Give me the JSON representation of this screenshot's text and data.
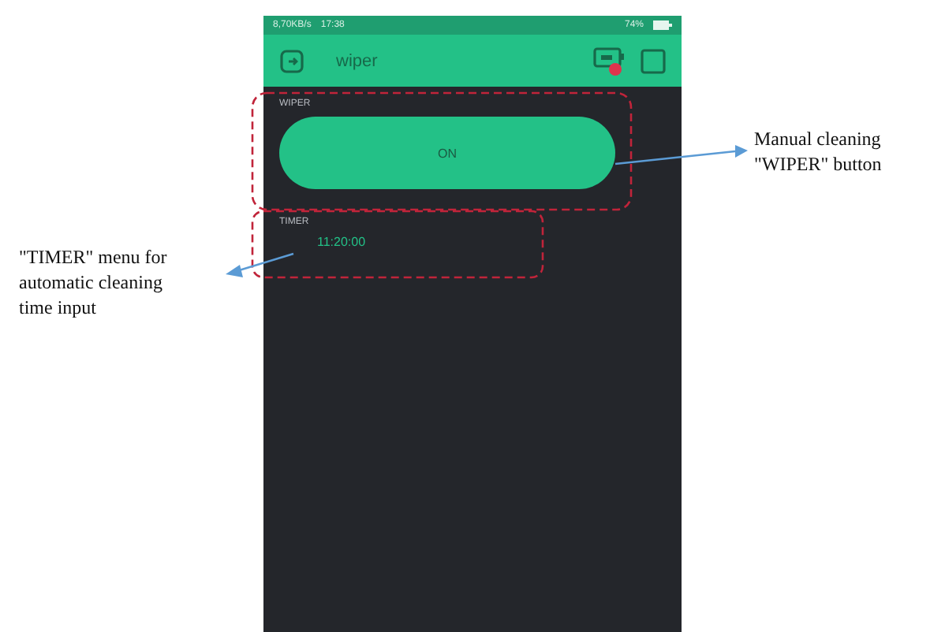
{
  "status_bar": {
    "network": "8,70KB/s",
    "time": "17:38",
    "battery": "74%"
  },
  "app_bar": {
    "title": "wiper"
  },
  "widgets": [
    {
      "kind": "button",
      "label": "WIPER",
      "value": "ON",
      "on": true
    },
    {
      "kind": "timer",
      "label": "TIMER",
      "value": "11:20:00"
    }
  ],
  "annotations": [
    {
      "text": "Manual cleaning \"WIPER\" button",
      "kind": "right"
    },
    {
      "text": "\"TIMER\" menu for automatic cleaning time input",
      "kind": "left"
    }
  ]
}
